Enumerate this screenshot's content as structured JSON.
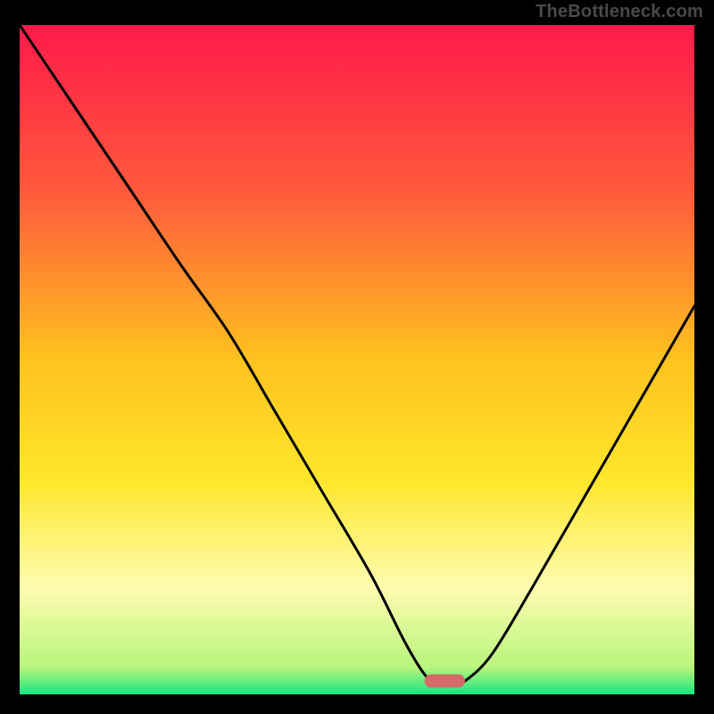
{
  "watermark": "TheBottleneck.com",
  "chart_data": {
    "type": "line",
    "title": "",
    "xlabel": "",
    "ylabel": "",
    "xlim": [
      0,
      100
    ],
    "ylim": [
      0,
      100
    ],
    "grid": false,
    "legend": false,
    "gradient_stops": [
      {
        "pct": 0,
        "color": "#ff1a4a"
      },
      {
        "pct": 25,
        "color": "#ff5a3c"
      },
      {
        "pct": 50,
        "color": "#ffc21f"
      },
      {
        "pct": 68,
        "color": "#ffe62b"
      },
      {
        "pct": 84,
        "color": "#fffcb0"
      },
      {
        "pct": 96,
        "color": "#b8f57c"
      },
      {
        "pct": 100,
        "color": "#17e680"
      }
    ],
    "marker": {
      "x": 63,
      "y": 2,
      "color": "#d46a6a",
      "rx": 4,
      "width": 6,
      "height": 2
    },
    "series": [
      {
        "name": "curve",
        "x": [
          0,
          8,
          16,
          24,
          31,
          38,
          45,
          52,
          57,
          60,
          62,
          64,
          66,
          70,
          76,
          84,
          92,
          100
        ],
        "y": [
          100,
          88,
          76,
          64,
          54,
          42,
          30,
          18,
          8,
          3,
          1.5,
          1.5,
          2,
          6,
          16,
          30,
          44,
          58
        ]
      }
    ],
    "axes": {
      "x_min": 0,
      "x_max": 100,
      "y_min": 0,
      "y_max": 100
    }
  }
}
